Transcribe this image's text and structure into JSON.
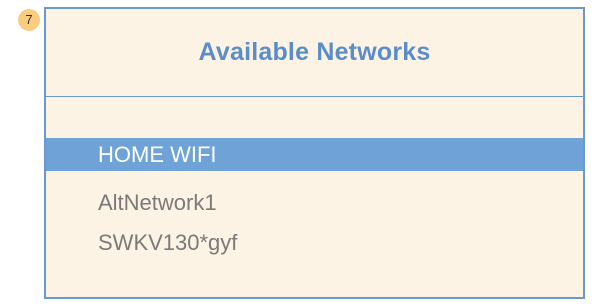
{
  "step": {
    "number": "7"
  },
  "panel": {
    "title": "Available Networks"
  },
  "networks": [
    {
      "name": "HOME WIFI",
      "selected": true
    },
    {
      "name": "AltNetwork1",
      "selected": false
    },
    {
      "name": "SWKV130*gyf",
      "selected": false
    }
  ],
  "colors": {
    "panel_background": "#fdf3e4",
    "border": "#6b99cf",
    "title_text": "#5b8ec9",
    "selected_background": "#6fa3d8",
    "selected_text": "#ffffff",
    "unselected_text": "#7a7a7a",
    "badge": "#f9cc7f"
  }
}
